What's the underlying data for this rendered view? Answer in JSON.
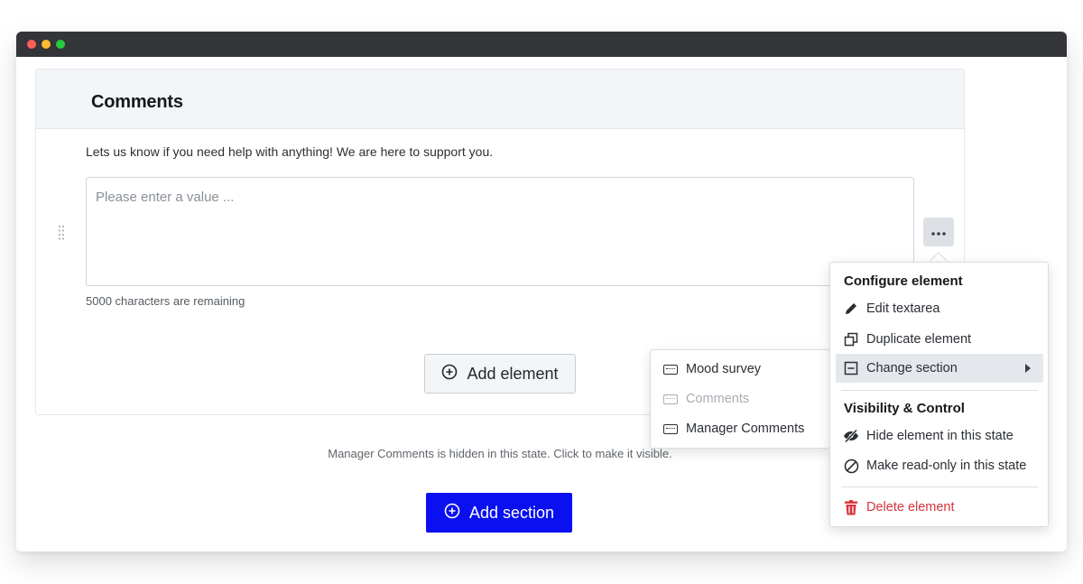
{
  "section": {
    "title": "Comments",
    "help_text": "Lets us know if you need help with anything! We are here to support you.",
    "textarea_placeholder": "Please enter a value ...",
    "remaining_text": "5000 characters are remaining",
    "add_element_label": "Add element"
  },
  "hidden_notice": "Manager Comments is hidden in this state. Click to make it visible.",
  "add_section_label": "Add section",
  "context_menu": {
    "configure_heading": "Configure element",
    "items": {
      "edit": "Edit textarea",
      "duplicate": "Duplicate element",
      "change_section": "Change section"
    },
    "visibility_heading": "Visibility & Control",
    "visibility_items": {
      "hide": "Hide element in this state",
      "readonly": "Make read-only in this state"
    },
    "delete": "Delete element"
  },
  "section_submenu": [
    {
      "label": "Mood survey",
      "disabled": false
    },
    {
      "label": "Comments",
      "disabled": true
    },
    {
      "label": "Manager Comments",
      "disabled": false
    }
  ],
  "colors": {
    "primary": "#0a10f0",
    "danger": "#d6333b",
    "titlebar": "#343538"
  },
  "icons": {
    "more": "more-horizontal-icon",
    "edit": "pencil-icon",
    "duplicate": "copy-icon",
    "change_section": "section-icon",
    "hide": "eye-slash-icon",
    "readonly": "ban-icon",
    "delete": "trash-icon",
    "add": "plus-circle-icon"
  }
}
